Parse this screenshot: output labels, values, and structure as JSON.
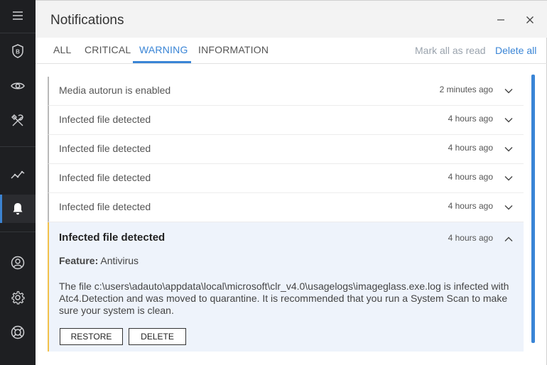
{
  "window": {
    "title": "Notifications"
  },
  "tabs": [
    {
      "label": "ALL"
    },
    {
      "label": "CRITICAL"
    },
    {
      "label": "WARNING"
    },
    {
      "label": "INFORMATION"
    }
  ],
  "actions": {
    "mark_all_read": "Mark all as read",
    "delete_all": "Delete all"
  },
  "notifications": [
    {
      "title": "Media autorun is enabled",
      "time": "2 minutes ago"
    },
    {
      "title": "Infected file detected",
      "time": "4 hours ago"
    },
    {
      "title": "Infected file detected",
      "time": "4 hours ago"
    },
    {
      "title": "Infected file detected",
      "time": "4 hours ago"
    },
    {
      "title": "Infected file detected",
      "time": "4 hours ago"
    }
  ],
  "expanded": {
    "title": "Infected file detected",
    "time": "4 hours ago",
    "feature_label": "Feature:",
    "feature_value": "Antivirus",
    "description": "The file c:\\users\\adauto\\appdata\\local\\microsoft\\clr_v4.0\\usagelogs\\imageglass.exe.log is infected with Atc4.Detection and was moved to quarantine. It is recommended that you run a System Scan to make sure your system is clean.",
    "restore_label": "RESTORE",
    "delete_label": "DELETE"
  },
  "colors": {
    "accent": "#3a85d6",
    "warning": "#f2c14b",
    "sidebar": "#1e1f22"
  }
}
